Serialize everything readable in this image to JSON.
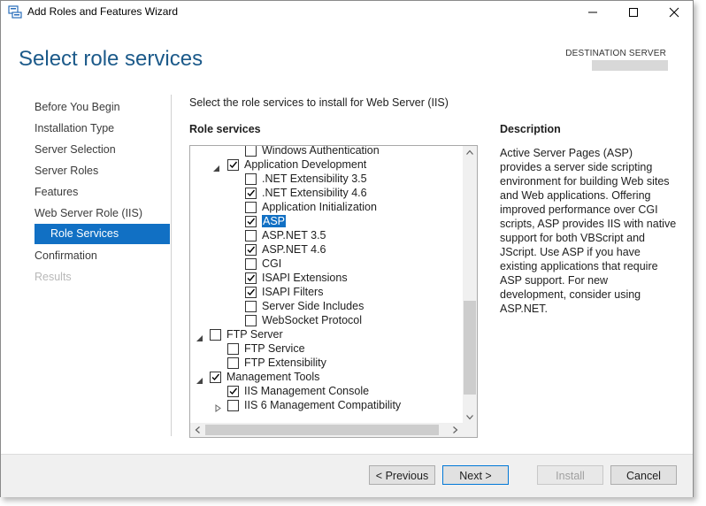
{
  "window": {
    "title": "Add Roles and Features Wizard"
  },
  "header": {
    "page_title": "Select role services",
    "destination_label": "DESTINATION SERVER"
  },
  "nav": {
    "items": [
      {
        "label": "Before You Begin"
      },
      {
        "label": "Installation Type"
      },
      {
        "label": "Server Selection"
      },
      {
        "label": "Server Roles"
      },
      {
        "label": "Features"
      },
      {
        "label": "Web Server Role (IIS)"
      },
      {
        "label": "Role Services"
      },
      {
        "label": "Confirmation"
      },
      {
        "label": "Results"
      }
    ]
  },
  "main": {
    "instruction": "Select the role services to install for Web Server (IIS)",
    "role_services_header": "Role services",
    "description_header": "Description",
    "description_text": "Active Server Pages (ASP) provides a server side scripting environment for building Web sites and Web applications. Offering improved performance over CGI scripts, ASP provides IIS with native support for both VBScript and JScript. Use ASP if you have existing applications that require ASP support. For new development, consider using ASP.NET."
  },
  "tree": {
    "items": [
      {
        "label": "Windows Authentication",
        "checked": false
      },
      {
        "label": "Application Development",
        "checked": true
      },
      {
        "label": ".NET Extensibility 3.5",
        "checked": false
      },
      {
        "label": ".NET Extensibility 4.6",
        "checked": true
      },
      {
        "label": "Application Initialization",
        "checked": false
      },
      {
        "label": "ASP",
        "checked": true
      },
      {
        "label": "ASP.NET 3.5",
        "checked": false
      },
      {
        "label": "ASP.NET 4.6",
        "checked": true
      },
      {
        "label": "CGI",
        "checked": false
      },
      {
        "label": "ISAPI Extensions",
        "checked": true
      },
      {
        "label": "ISAPI Filters",
        "checked": true
      },
      {
        "label": "Server Side Includes",
        "checked": false
      },
      {
        "label": "WebSocket Protocol",
        "checked": false
      },
      {
        "label": "FTP Server",
        "checked": false
      },
      {
        "label": "FTP Service",
        "checked": false
      },
      {
        "label": "FTP Extensibility",
        "checked": false
      },
      {
        "label": "Management Tools",
        "checked": true
      },
      {
        "label": "IIS Management Console",
        "checked": true
      },
      {
        "label": "IIS 6 Management Compatibility",
        "checked": false
      }
    ]
  },
  "footer": {
    "previous_label": "< Previous",
    "next_label": "Next >",
    "install_label": "Install",
    "cancel_label": "Cancel"
  }
}
